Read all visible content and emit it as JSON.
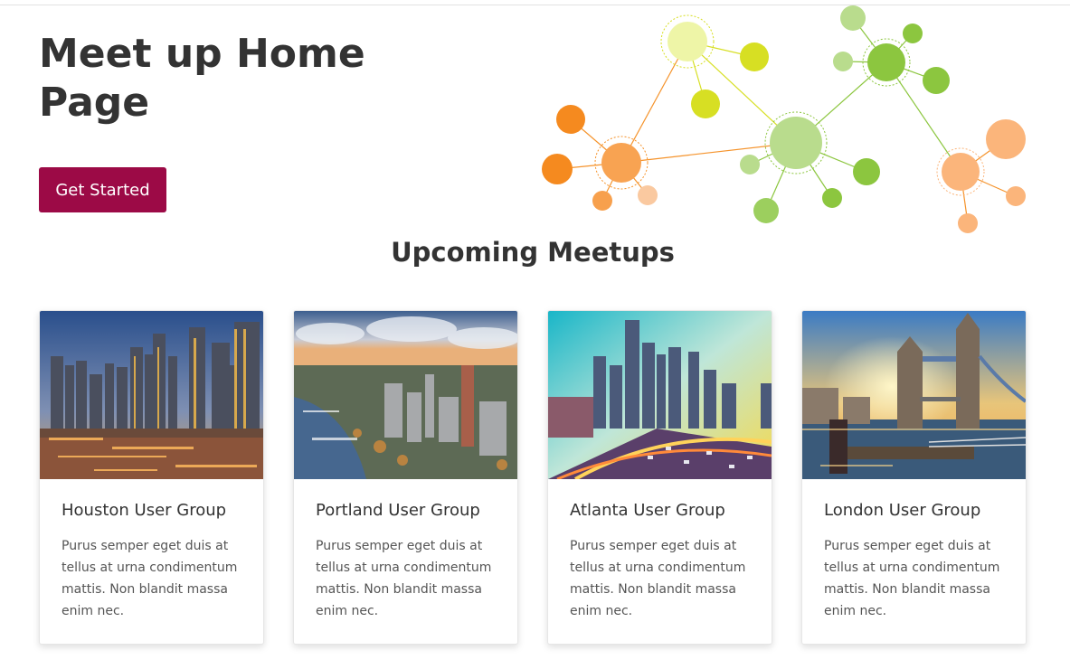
{
  "hero": {
    "title": "Meet up Home Page",
    "cta_label": "Get Started"
  },
  "section": {
    "title": "Upcoming Meetups"
  },
  "colors": {
    "accent": "#9c0a46",
    "orange": "#f5932b",
    "green": "#8cc63f",
    "lime": "#d7df23",
    "peach": "#fbb57b"
  },
  "cards": [
    {
      "title": "Houston User Group",
      "text": "Purus semper eget duis at tellus at urna condimentum mattis. Non blandit massa enim nec.",
      "image": "houston-skyline-image"
    },
    {
      "title": "Portland User Group",
      "text": "Purus semper eget duis at tellus at urna condimentum mattis. Non blandit massa enim nec.",
      "image": "portland-aerial-image"
    },
    {
      "title": "Atlanta User Group",
      "text": "Purus semper eget duis at tellus at urna condimentum mattis. Non blandit massa enim nec.",
      "image": "atlanta-highway-image"
    },
    {
      "title": "London User Group",
      "text": "Purus semper eget duis at tellus at urna condimentum mattis. Non blandit massa enim nec.",
      "image": "london-tower-bridge-image"
    }
  ]
}
